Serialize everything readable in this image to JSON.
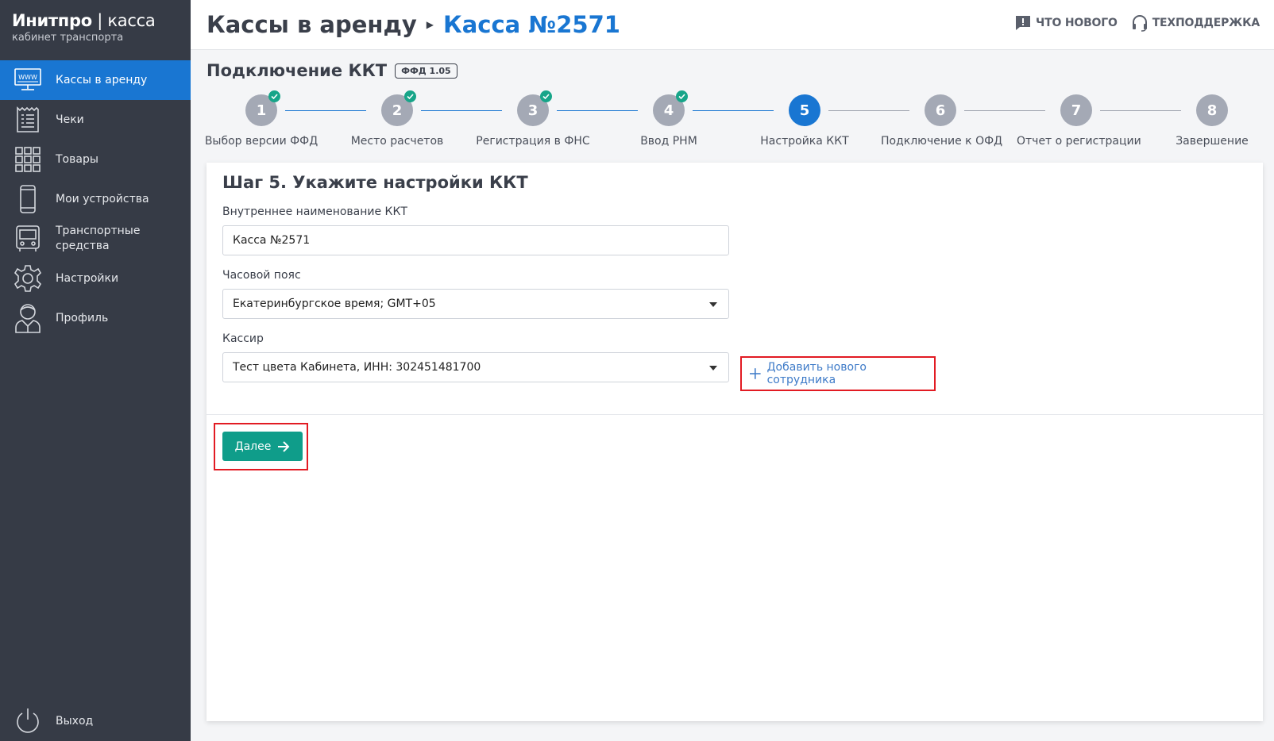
{
  "brand": {
    "name_bold": "Инитпро",
    "name_sep": " | ",
    "name_thin": "касса",
    "subtitle": "кабинет транспорта"
  },
  "sidebar": {
    "items": [
      {
        "label": "Кассы в аренду",
        "icon": "www-monitor-icon",
        "active": true
      },
      {
        "label": "Чеки",
        "icon": "receipt-icon"
      },
      {
        "label": "Товары",
        "icon": "grid-icon"
      },
      {
        "label": "Мои устройства",
        "icon": "phone-icon"
      },
      {
        "label": "Транспортные средства",
        "icon": "bus-icon"
      },
      {
        "label": "Настройки",
        "icon": "gear-icon"
      },
      {
        "label": "Профиль",
        "icon": "user-icon"
      }
    ],
    "logout": "Выход"
  },
  "header": {
    "root": "Кассы в аренду",
    "current": "Касса №2571",
    "whats_new": "ЧТО НОВОГО",
    "support": "ТЕХПОДДЕРЖКА"
  },
  "page": {
    "title": "Подключение ККТ",
    "badge": "ФФД 1.05"
  },
  "steps": [
    {
      "num": "1",
      "label": "Выбор версии ФФД",
      "done": true
    },
    {
      "num": "2",
      "label": "Место расчетов",
      "done": true
    },
    {
      "num": "3",
      "label": "Регистрация в ФНС",
      "done": true
    },
    {
      "num": "4",
      "label": "Ввод РНМ",
      "done": true
    },
    {
      "num": "5",
      "label": "Настройка ККТ",
      "current": true
    },
    {
      "num": "6",
      "label": "Подключение к ОФД"
    },
    {
      "num": "7",
      "label": "Отчет о регистрации"
    },
    {
      "num": "8",
      "label": "Завершение"
    }
  ],
  "form": {
    "heading": "Шаг 5. Укажите настройки ККТ",
    "name_label": "Внутреннее наименование ККТ",
    "name_value": "Касса №2571",
    "tz_label": "Часовой пояс",
    "tz_value": "Екатеринбургское время; GMT+05",
    "cashier_label": "Кассир",
    "cashier_value": "Тест цвета Кабинета, ИНН: 302451481700",
    "add_employee": "Добавить нового сотрудника",
    "next": "Далее"
  },
  "colors": {
    "accent": "#1976d2",
    "sidebar": "#363b46",
    "success": "#17a589",
    "primary_button": "#0f9d8a",
    "highlight": "#e21b23"
  }
}
